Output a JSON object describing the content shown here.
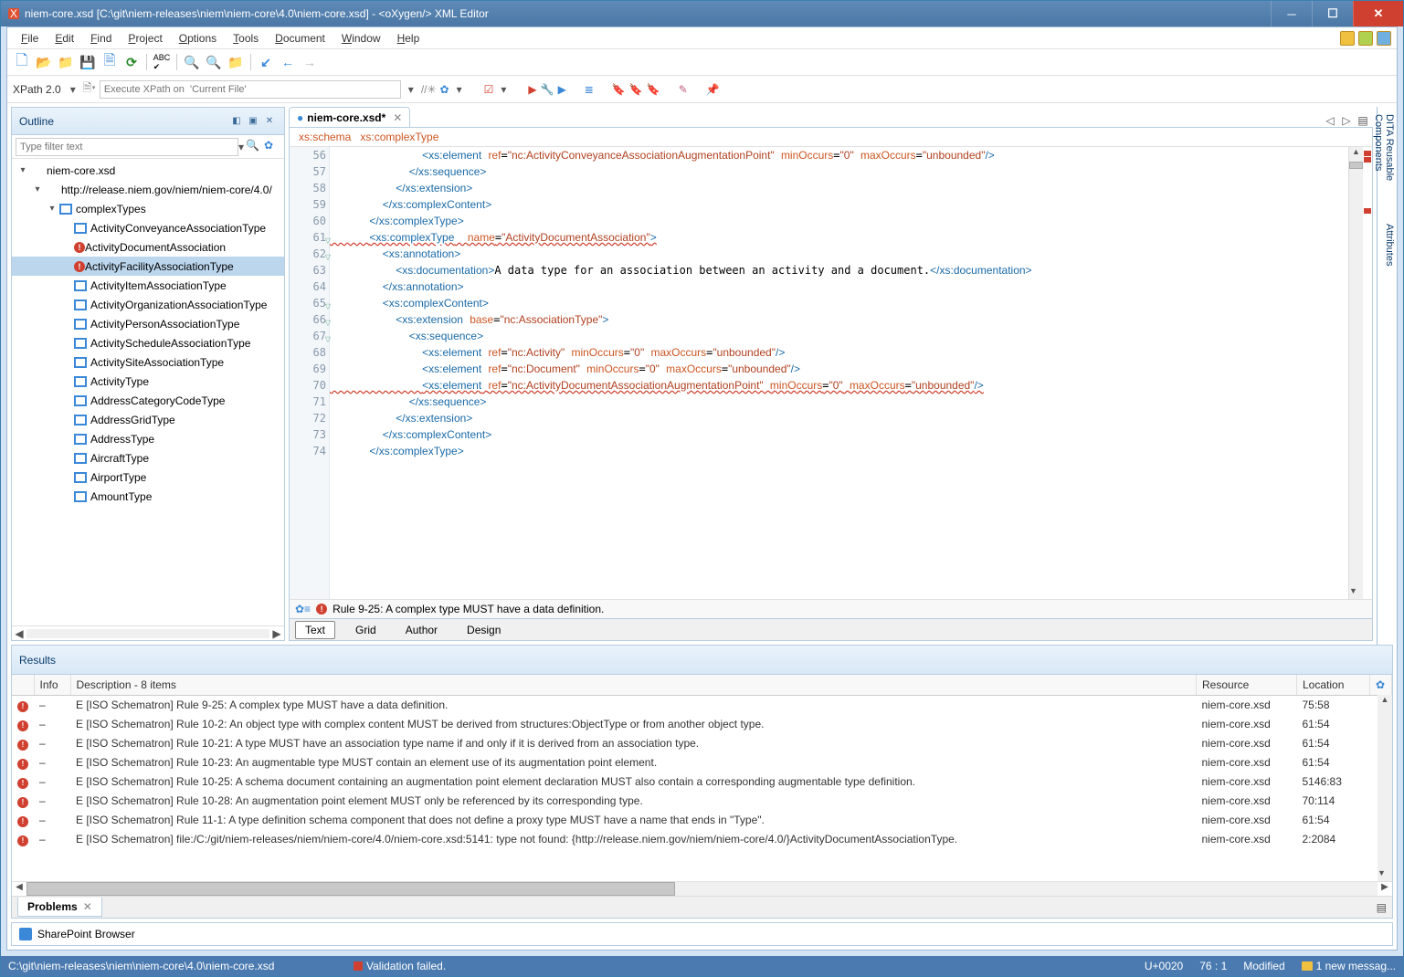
{
  "titlebar": {
    "text": "niem-core.xsd [C:\\git\\niem-releases\\niem\\niem-core\\4.0\\niem-core.xsd] - <oXygen/> XML Editor"
  },
  "menubar": {
    "items": [
      "File",
      "Edit",
      "Find",
      "Project",
      "Options",
      "Tools",
      "Document",
      "Window",
      "Help"
    ]
  },
  "xpathbar": {
    "label": "XPath 2.0",
    "placeholder": "Execute XPath on  'Current File'"
  },
  "outline": {
    "title": "Outline",
    "filter_placeholder": "Type filter text",
    "tree": [
      {
        "level": 0,
        "exp": "▾",
        "ico": "",
        "label": "niem-core.xsd"
      },
      {
        "level": 1,
        "exp": "▾",
        "ico": "",
        "label": "http://release.niem.gov/niem/niem-core/4.0/"
      },
      {
        "level": 2,
        "exp": "▾",
        "ico": "box",
        "label": "complexTypes"
      },
      {
        "level": 3,
        "exp": "",
        "ico": "box",
        "label": "ActivityConveyanceAssociationType"
      },
      {
        "level": 3,
        "exp": "",
        "ico": "err",
        "label": "ActivityDocumentAssociation"
      },
      {
        "level": 3,
        "exp": "",
        "ico": "err",
        "label": "ActivityFacilityAssociationType",
        "selected": true
      },
      {
        "level": 3,
        "exp": "",
        "ico": "box",
        "label": "ActivityItemAssociationType"
      },
      {
        "level": 3,
        "exp": "",
        "ico": "box",
        "label": "ActivityOrganizationAssociationType"
      },
      {
        "level": 3,
        "exp": "",
        "ico": "box",
        "label": "ActivityPersonAssociationType"
      },
      {
        "level": 3,
        "exp": "",
        "ico": "box",
        "label": "ActivityScheduleAssociationType"
      },
      {
        "level": 3,
        "exp": "",
        "ico": "box",
        "label": "ActivitySiteAssociationType"
      },
      {
        "level": 3,
        "exp": "",
        "ico": "box",
        "label": "ActivityType"
      },
      {
        "level": 3,
        "exp": "",
        "ico": "box",
        "label": "AddressCategoryCodeType"
      },
      {
        "level": 3,
        "exp": "",
        "ico": "box",
        "label": "AddressGridType"
      },
      {
        "level": 3,
        "exp": "",
        "ico": "box",
        "label": "AddressType"
      },
      {
        "level": 3,
        "exp": "",
        "ico": "box",
        "label": "AircraftType"
      },
      {
        "level": 3,
        "exp": "",
        "ico": "box",
        "label": "AirportType"
      },
      {
        "level": 3,
        "exp": "",
        "ico": "box",
        "label": "AmountType"
      }
    ]
  },
  "editor": {
    "tab_name": "niem-core.xsd*",
    "breadcrumb": {
      "a": "xs:schema",
      "b": "xs:complexType"
    },
    "first_line": 56,
    "lines": [
      {
        "html": "              <span class='c-tag'>&lt;xs:element</span> <span class='c-attr'>ref</span>=<span class='c-str'>\"nc:ActivityConveyanceAssociationAugmentationPoint\"</span> <span class='c-attr'>minOccurs</span>=<span class='c-str'>\"0\"</span> <span class='c-attr'>maxOccurs</span>=<span class='c-str'>\"unbounded\"</span><span class='c-tag'>/&gt;</span>"
      },
      {
        "html": "            <span class='c-tag'>&lt;/xs:sequence&gt;</span>"
      },
      {
        "html": "          <span class='c-tag'>&lt;/xs:extension&gt;</span>"
      },
      {
        "html": "        <span class='c-tag'>&lt;/xs:complexContent&gt;</span>"
      },
      {
        "html": "      <span class='c-tag'>&lt;/xs:complexType&gt;</span>"
      },
      {
        "html": "      <span class='c-tag'>&lt;xs:complexType</span>  <span class='c-attr'>name</span>=<span class='c-str'>\"ActivityDocumentAssociation\"</span><span class='c-tag'>&gt;</span>",
        "hl": true
      },
      {
        "html": "        <span class='c-tag'>&lt;xs:annotation&gt;</span>"
      },
      {
        "html": "          <span class='c-tag'>&lt;xs:documentation&gt;</span>A data type for an association between an activity and a document.<span class='c-tag'>&lt;/xs:documentation&gt;</span>"
      },
      {
        "html": "        <span class='c-tag'>&lt;/xs:annotation&gt;</span>"
      },
      {
        "html": "        <span class='c-tag'>&lt;xs:complexContent&gt;</span>"
      },
      {
        "html": "          <span class='c-tag'>&lt;xs:extension</span> <span class='c-attr'>base</span>=<span class='c-str'>\"nc:AssociationType\"</span><span class='c-tag'>&gt;</span>"
      },
      {
        "html": "            <span class='c-tag'>&lt;xs:sequence&gt;</span>"
      },
      {
        "html": "              <span class='c-tag'>&lt;xs:element</span> <span class='c-attr'>ref</span>=<span class='c-str'>\"nc:Activity\"</span> <span class='c-attr'>minOccurs</span>=<span class='c-str'>\"0\"</span> <span class='c-attr'>maxOccurs</span>=<span class='c-str'>\"unbounded\"</span><span class='c-tag'>/&gt;</span>"
      },
      {
        "html": "              <span class='c-tag'>&lt;xs:element</span> <span class='c-attr'>ref</span>=<span class='c-str'>\"nc:Document\"</span> <span class='c-attr'>minOccurs</span>=<span class='c-str'>\"0\"</span> <span class='c-attr'>maxOccurs</span>=<span class='c-str'>\"unbounded\"</span><span class='c-tag'>/&gt;</span>"
      },
      {
        "html": "              <span class='c-tag'>&lt;xs:element</span> <span class='c-attr'>ref</span>=<span class='c-str'>\"nc:ActivityDocumentAssociationAugmentationPoint\"</span> <span class='c-attr'>minOccurs</span>=<span class='c-str'>\"0\"</span> <span class='c-attr'>maxOccurs</span>=<span class='c-str'>\"unbounded\"</span><span class='c-tag'>/&gt;</span>",
        "hl": true
      },
      {
        "html": "            <span class='c-tag'>&lt;/xs:sequence&gt;</span>"
      },
      {
        "html": "          <span class='c-tag'>&lt;/xs:extension&gt;</span>"
      },
      {
        "html": "        <span class='c-tag'>&lt;/xs:complexContent&gt;</span>"
      },
      {
        "html": "      <span class='c-tag'>&lt;/xs:complexType&gt;</span>"
      }
    ],
    "status_msg": "Rule 9-25: A complex type MUST have a data definition.",
    "modes": [
      "Text",
      "Grid",
      "Author",
      "Design"
    ]
  },
  "right_sidebar": [
    "DITA Reusable Components",
    "Attributes"
  ],
  "results": {
    "title": "Results",
    "columns": {
      "info": "Info",
      "desc": "Description - 8 items",
      "resource": "Resource",
      "location": "Location"
    },
    "rows": [
      {
        "desc": "E [ISO Schematron] Rule 9-25: A complex type MUST have a data definition.",
        "res": "niem-core.xsd",
        "loc": "75:58"
      },
      {
        "desc": "E [ISO Schematron] Rule 10-2: An object type with complex content MUST be derived from structures:ObjectType or from another object type.",
        "res": "niem-core.xsd",
        "loc": "61:54"
      },
      {
        "desc": "E [ISO Schematron] Rule 10-21: A type MUST have an association type name if and only if it is derived from an association type.",
        "res": "niem-core.xsd",
        "loc": "61:54"
      },
      {
        "desc": "E [ISO Schematron] Rule 10-23: An augmentable type MUST contain an element use of its augmentation point element.",
        "res": "niem-core.xsd",
        "loc": "61:54"
      },
      {
        "desc": "E [ISO Schematron] Rule 10-25: A schema document containing an augmentation point element declaration MUST also contain a corresponding augmentable type definition.",
        "res": "niem-core.xsd",
        "loc": "5146:83"
      },
      {
        "desc": "E [ISO Schematron] Rule 10-28: An augmentation point element MUST only be referenced by its corresponding type.",
        "res": "niem-core.xsd",
        "loc": "70:114"
      },
      {
        "desc": "E [ISO Schematron] Rule 11-1: A type definition schema component that does not define a proxy type MUST have a name that ends in \"Type\".",
        "res": "niem-core.xsd",
        "loc": "61:54"
      },
      {
        "desc": "E [ISO Schematron] file:/C:/git/niem-releases/niem/niem-core/4.0/niem-core.xsd:5141: type not found: {http://release.niem.gov/niem/niem-core/4.0/}ActivityDocumentAssociationType.",
        "res": "niem-core.xsd",
        "loc": "2:2084"
      }
    ]
  },
  "bottom_tabs": {
    "problems": "Problems"
  },
  "sharepoint": {
    "label": "SharePoint Browser"
  },
  "statusbar": {
    "path": "C:\\git\\niem-releases\\niem\\niem-core\\4.0\\niem-core.xsd",
    "validation": "Validation failed.",
    "unicode": "U+0020",
    "pos": "76 : 1",
    "modified": "Modified",
    "msg": "1 new messag..."
  }
}
